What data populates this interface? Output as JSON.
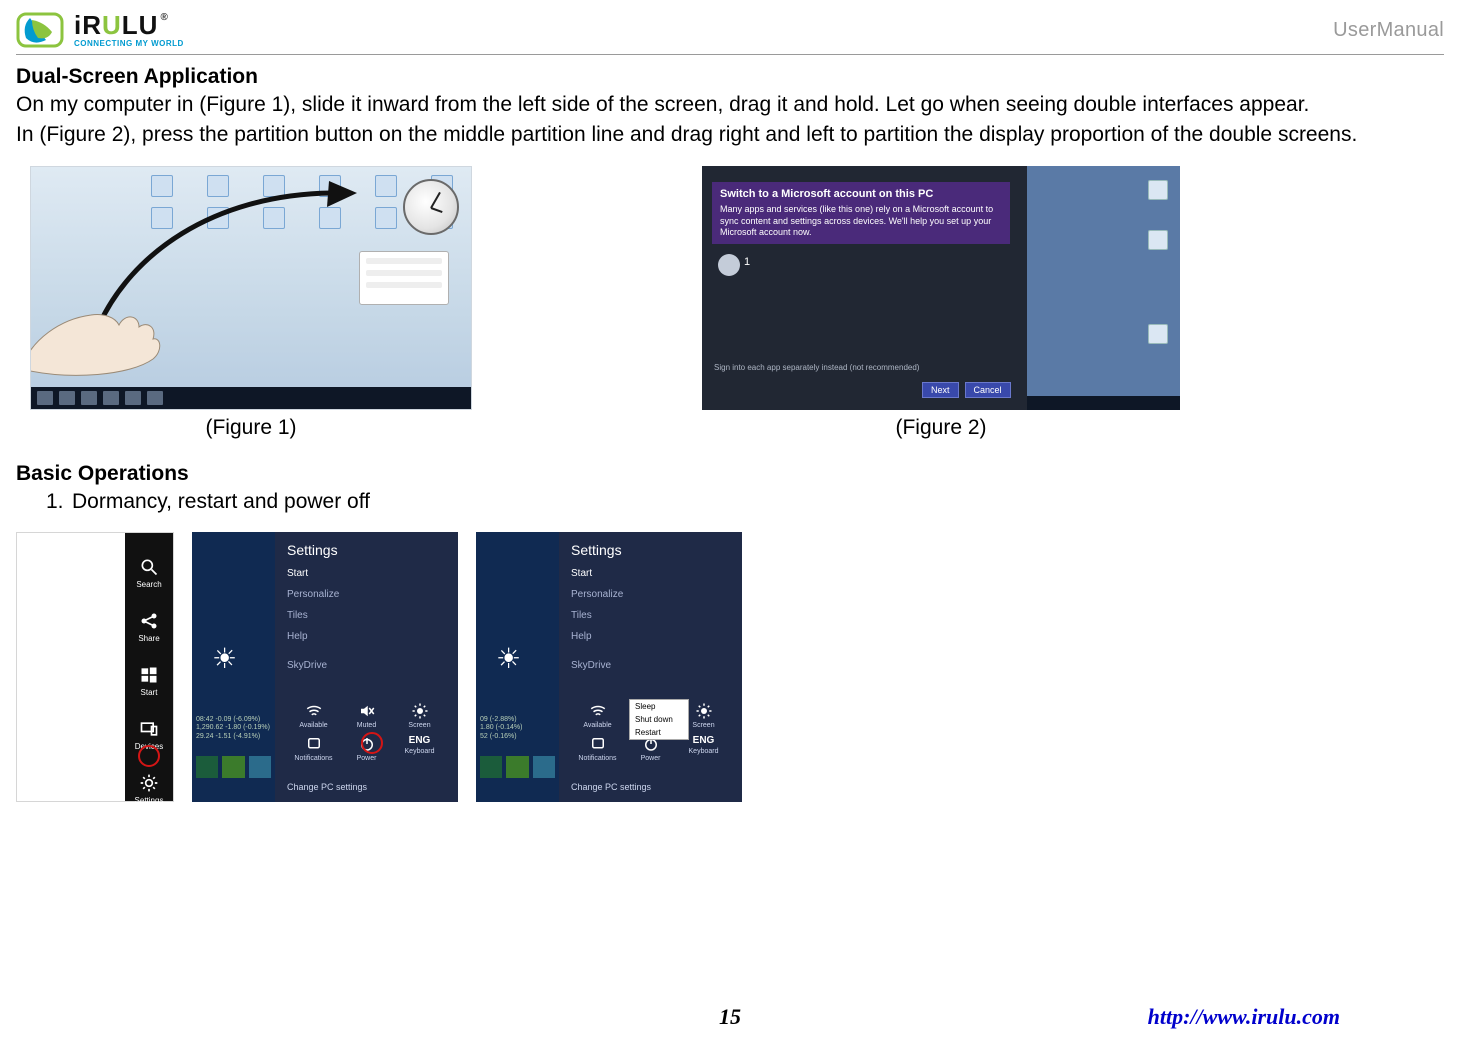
{
  "header": {
    "brand_i": "i",
    "brand_r": "R",
    "brand_u": "U",
    "brand_lu": "LU",
    "registered": "®",
    "tagline": "CONNECTING MY WORLD",
    "right": "UserManual"
  },
  "sections": {
    "dual_title": "Dual-Screen Application",
    "dual_p1": "On my computer in (Figure 1), slide it inward from the left side of the screen, drag it and hold. Let go when seeing double interfaces appear.",
    "dual_p2": "In (Figure 2), press the partition button on the middle partition line and drag right and left to partition the display proportion of the double screens.",
    "basic_title": "Basic Operations",
    "basic_item1_num": "1.",
    "basic_item1_text": "Dormancy, restart and power off"
  },
  "figures": {
    "fig1_caption": "(Figure 1)",
    "fig2_caption": "(Figure 2)",
    "fig2_banner_title": "Switch to a Microsoft account on this PC",
    "fig2_banner_body": "Many apps and services (like this one) rely on a Microsoft account to sync content and settings across devices. We'll help you set up your Microsoft account now.",
    "fig2_note": "Sign into each app separately instead (not recommended)",
    "fig2_btn1": "Next",
    "fig2_btn2": "Cancel"
  },
  "charms": {
    "search": "Search",
    "share": "Share",
    "start": "Start",
    "devices": "Devices",
    "settings": "Settings"
  },
  "settings": {
    "header": "Settings",
    "opt_start": "Start",
    "opt_personalize": "Personalize",
    "opt_tiles": "Tiles",
    "opt_help": "Help",
    "wifi": "SkyDrive",
    "icons": {
      "available": "Available",
      "muted": "Muted",
      "screen": "Screen",
      "notifications": "Notifications",
      "power": "Power",
      "keyboard": "Keyboard",
      "eng": "ENG"
    },
    "quotes": "08:42 -0.09 (-6.09%)\n1,290.62 -1.80 (-0.19%)\n29.24 -1.51 (-4.91%)",
    "quotes2": "09 (-2.88%)\n1.80 (-0.14%)\n52 (-0.16%)",
    "shutdown": {
      "sleep": "Sleep",
      "shutdown": "Shut down",
      "restart": "Restart"
    },
    "change": "Change PC settings"
  },
  "footer": {
    "page": "15",
    "url": "http://www.irulu.com"
  }
}
